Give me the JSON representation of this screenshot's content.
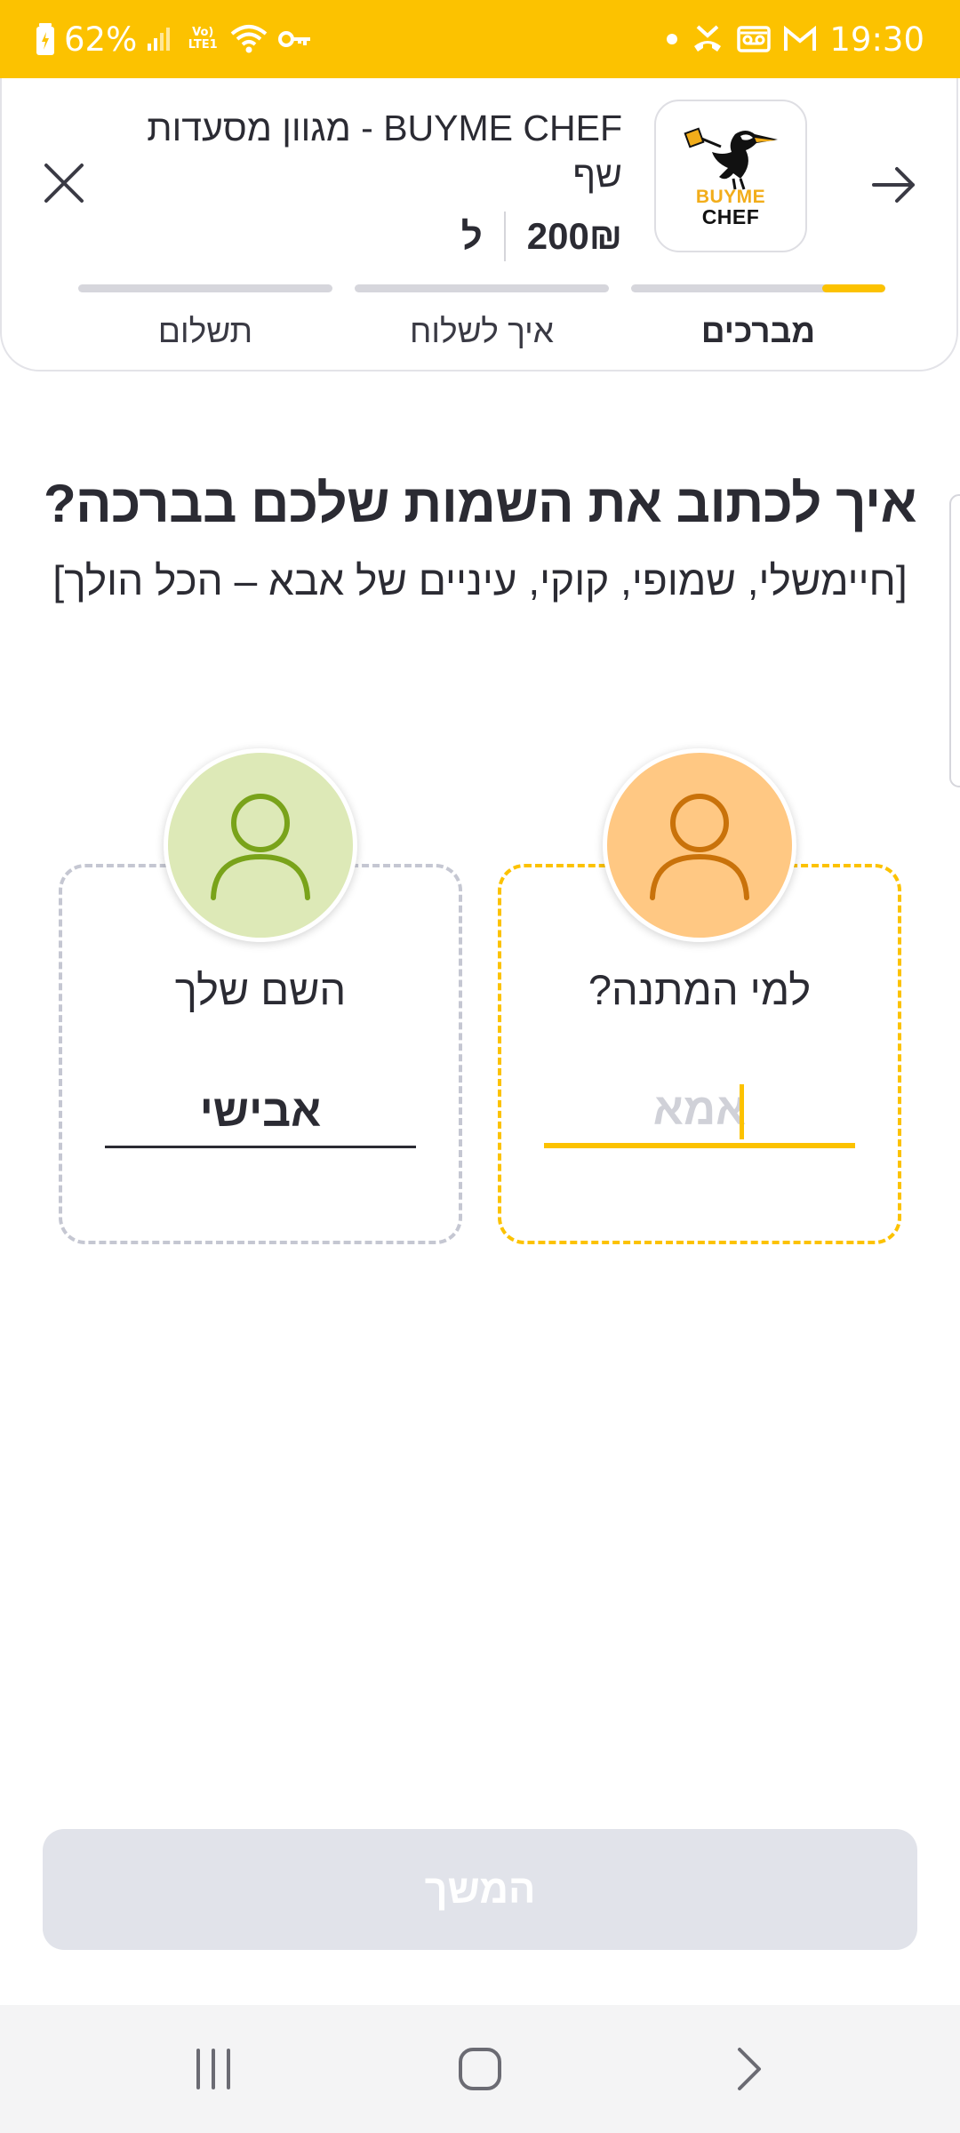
{
  "status_bar": {
    "battery_percent": "62%",
    "network_label": "Vo) LTE1",
    "time": "19:30",
    "icons": [
      "battery-icon",
      "signal-icon",
      "wifi-icon",
      "vpn-key-icon",
      "dot-icon",
      "missed-call-icon",
      "voicemail-icon",
      "gmail-icon"
    ]
  },
  "header": {
    "product_title": "BUYME CHEF - מגוון מסעדות שף",
    "price": "200₪",
    "price_unit": "ל",
    "logo": {
      "line1": "BUYME",
      "line2": "CHEF"
    },
    "close_icon": "close-icon",
    "back_icon": "arrow-right-icon"
  },
  "steps": [
    {
      "label": "מברכים",
      "active": true,
      "progress": 0.25
    },
    {
      "label": "איך לשלוח",
      "active": false,
      "progress": 0
    },
    {
      "label": "תשלום",
      "active": false,
      "progress": 0
    }
  ],
  "question": "איך לכתוב את השמות שלכם בברכה?",
  "hint": "[חיימשלי, שמופי, קוקי, עיניים של אבא – הכל הולך]",
  "recipient": {
    "label": "למי המתנה?",
    "placeholder": "אמא",
    "value": "",
    "avatar_icon": "person-icon"
  },
  "sender": {
    "label": "השם שלך",
    "value": "אבישי",
    "avatar_icon": "person-icon"
  },
  "continue_label": "המשך",
  "colors": {
    "brand_yellow": "#fcc200",
    "recipient_avatar": "#ffc883",
    "sender_avatar": "#dde9b7",
    "disabled_button": "#e1e3ea"
  }
}
